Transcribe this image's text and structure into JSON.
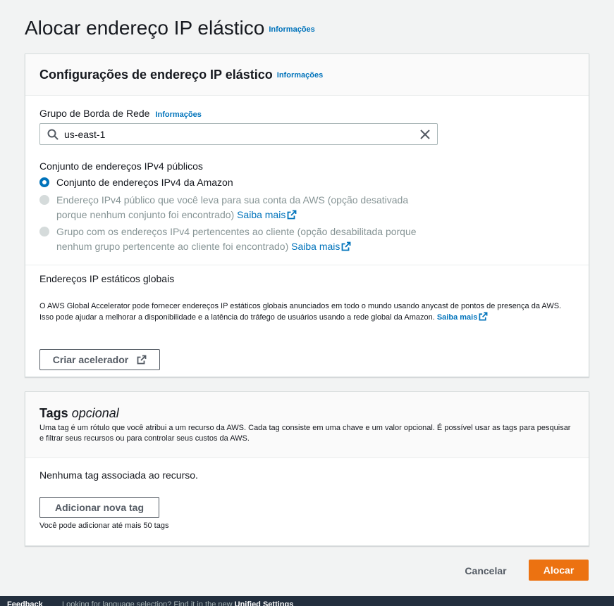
{
  "page": {
    "title": "Alocar endereço IP elástico",
    "info_link": "Informações"
  },
  "settings": {
    "title": "Configurações de endereço IP elástico",
    "info_link": "Informações",
    "border_group": {
      "label": "Grupo de Borda de Rede",
      "info_link": "Informações",
      "value": "us-east-1"
    },
    "ipv4_pool": {
      "label": "Conjunto de endereços IPv4 públicos",
      "options": [
        {
          "label": "Conjunto de endereços IPv4 da Amazon",
          "selected": true,
          "disabled": false
        },
        {
          "label": "Endereço IPv4 público que você leva para sua conta da AWS (opção desativada porque nenhum conjunto foi encontrado)",
          "link": "Saiba mais",
          "selected": false,
          "disabled": true
        },
        {
          "label": "Grupo com os endereços IPv4 pertencentes ao cliente (opção desabilitada porque nenhum grupo pertencente ao cliente foi encontrado)",
          "link": "Saiba mais",
          "selected": false,
          "disabled": true
        }
      ]
    },
    "global_ips": {
      "label": "Endereços IP estáticos globais",
      "description": "O AWS Global Accelerator pode fornecer endereços IP estáticos globais anunciados em todo o mundo usando anycast de pontos de presença da AWS. Isso pode ajudar a melhorar a disponibilidade e a latência do tráfego de usuários usando a rede global da Amazon.",
      "link": "Saiba mais",
      "button": "Criar acelerador"
    }
  },
  "tags": {
    "title": "Tags",
    "optional": "opcional",
    "description": "Uma tag é um rótulo que você atribui a um recurso da AWS. Cada tag consiste em uma chave e um valor opcional. É possível usar as tags para pesquisar e filtrar seus recursos ou para controlar seus custos da AWS.",
    "empty": "Nenhuma tag associada ao recurso.",
    "add_button": "Adicionar nova tag",
    "limit": "Você pode adicionar até mais 50 tags"
  },
  "actions": {
    "cancel": "Cancelar",
    "submit": "Alocar"
  },
  "footer": {
    "feedback": "Feedback",
    "message": "Looking for language selection? Find it in the new",
    "settings_link": "Unified Settings"
  },
  "colors": {
    "primary": "#ec7211",
    "link": "#0073bb",
    "footer": "#232f3e"
  }
}
